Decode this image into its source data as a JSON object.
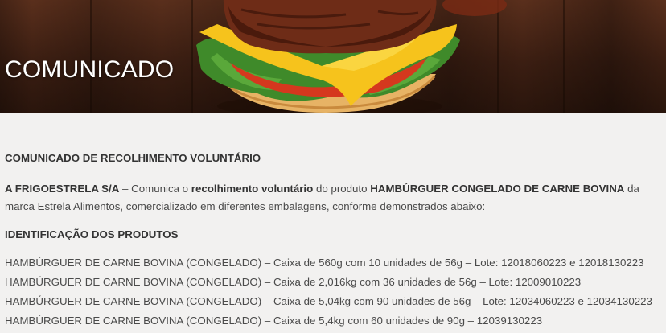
{
  "hero": {
    "title": "COMUNICADO",
    "image": "hamburger-photo"
  },
  "notice": {
    "heading": "COMUNICADO DE RECOLHIMENTO VOLUNTÁRIO",
    "company": "A FRIGOESTRELA S/A",
    "text_1": " – Comunica o ",
    "recall": "recolhimento voluntário",
    "text_2": " do produto ",
    "product": "HAMBÚRGUER CONGELADO DE CARNE BOVINA",
    "text_3": " da marca Estrela Alimentos, comercializado em diferentes embalagens, conforme demonstrados abaixo:"
  },
  "products": {
    "heading": "IDENTIFICAÇÃO DOS PRODUTOS",
    "rows": [
      "HAMBÚRGUER DE CARNE BOVINA (CONGELADO) – Caixa de 560g com 10 unidades de 56g – Lote: 12018060223 e 12018130223",
      "HAMBÚRGUER DE CARNE BOVINA (CONGELADO) – Caixa de 2,016kg com 36 unidades de 56g – Lote: 12009010223",
      "HAMBÚRGUER DE CARNE BOVINA (CONGELADO) – Caixa de 5,04kg com 90 unidades de 56g – Lote: 12034060223 e 12034130223",
      "HAMBÚRGUER DE CARNE BOVINA (CONGELADO) – Caixa de 5,4kg com 60 unidades de 90g – 12039130223"
    ]
  }
}
